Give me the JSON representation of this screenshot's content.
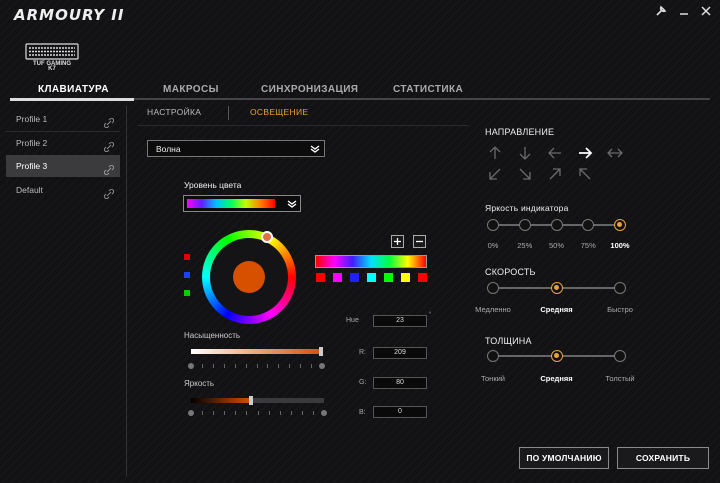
{
  "app": {
    "title": "ARMOURY II",
    "device_model_line1": "TUF GAMING",
    "device_model_line2": "K7"
  },
  "colors": {
    "accent": "#e8a33b",
    "background": "#121214",
    "selected_profile": "#3b3b3e"
  },
  "tabs": [
    {
      "label": "КЛАВИАТУРА",
      "active": true
    },
    {
      "label": "МАКРОСЫ",
      "active": false
    },
    {
      "label": "СИНХРОНИЗАЦИЯ",
      "active": false
    },
    {
      "label": "СТАТИСТИКА",
      "active": false
    }
  ],
  "profiles": [
    {
      "label": "Profile 1",
      "selected": false
    },
    {
      "label": "Profile 2",
      "selected": false
    },
    {
      "label": "Profile 3",
      "selected": true
    },
    {
      "label": "Default",
      "selected": false
    }
  ],
  "subtabs": [
    {
      "label": "НАСТРОЙКА",
      "active": false
    },
    {
      "label": "ОСВЕЩЕНИЕ",
      "active": true
    }
  ],
  "effect": {
    "selected": "Волна"
  },
  "color_level": {
    "label": "Уровень цвета"
  },
  "color": {
    "saturation_label": "Насыщенность",
    "saturation": 1.0,
    "brightness_label": "Яркость",
    "brightness": 0.45,
    "hue_label": "Hue",
    "hue": "23",
    "hue_unit": "°",
    "r_label": "R:",
    "r": "209",
    "g_label": "G:",
    "g": "80",
    "b_label": "B:",
    "b": "0",
    "swatch_colors": [
      "#ff0000",
      "#ff00ff",
      "#2020ff",
      "#00ffff",
      "#00ff00",
      "#ffff00",
      "#ff0000"
    ]
  },
  "direction": {
    "title": "НАПРАВЛЕНИЕ",
    "selected": "right-arrow"
  },
  "indicator_brightness": {
    "title": "Яркость индикатора",
    "levels": [
      "0%",
      "25%",
      "50%",
      "75%",
      "100%"
    ],
    "selected_index": 4
  },
  "speed": {
    "title": "СКОРОСТЬ",
    "levels": [
      "Медленно",
      "Средняя",
      "Быстро"
    ],
    "selected_index": 1
  },
  "thickness": {
    "title": "ТОЛЩИНА",
    "levels": [
      "Тонкий",
      "Средняя",
      "Толстый"
    ],
    "selected_index": 1
  },
  "buttons": {
    "default": "ПО УМОЛЧАНИЮ",
    "save": "СОХРАНИТЬ"
  },
  "window_icons": [
    "wrench-icon",
    "minimize-icon",
    "close-icon"
  ]
}
